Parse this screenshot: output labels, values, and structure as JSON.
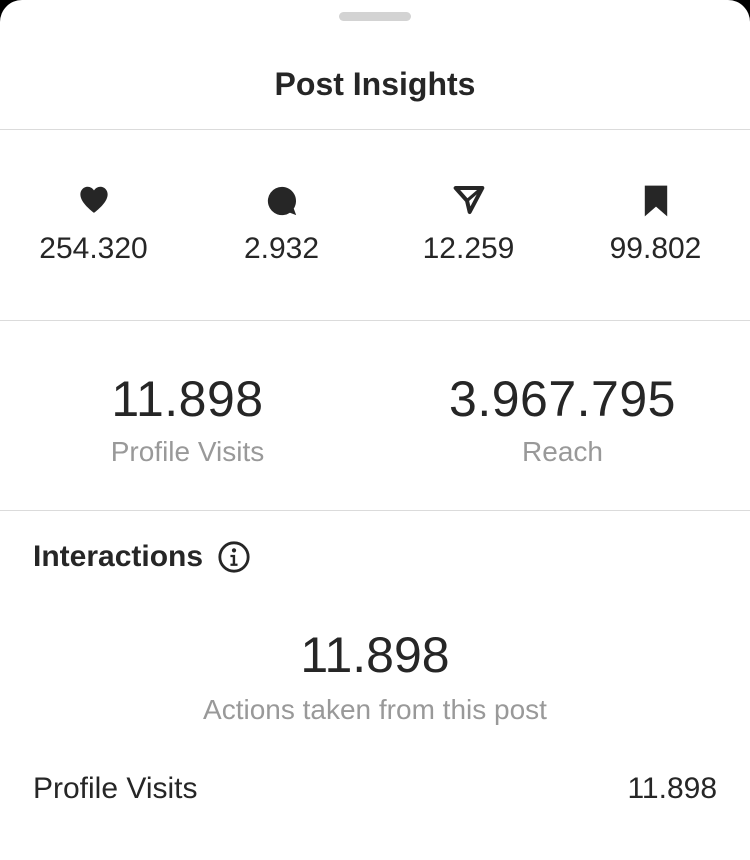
{
  "header": {
    "title": "Post Insights"
  },
  "stats": [
    {
      "icon": "heart-icon",
      "value": "254.320"
    },
    {
      "icon": "comment-icon",
      "value": "2.932"
    },
    {
      "icon": "share-icon",
      "value": "12.259"
    },
    {
      "icon": "bookmark-icon",
      "value": "99.802"
    }
  ],
  "overview": {
    "profile_visits": {
      "value": "11.898",
      "label": "Profile Visits"
    },
    "reach": {
      "value": "3.967.795",
      "label": "Reach"
    }
  },
  "interactions": {
    "title": "Interactions",
    "total": "11.898",
    "subtitle": "Actions taken from this post",
    "rows": [
      {
        "label": "Profile Visits",
        "value": "11.898"
      }
    ]
  }
}
